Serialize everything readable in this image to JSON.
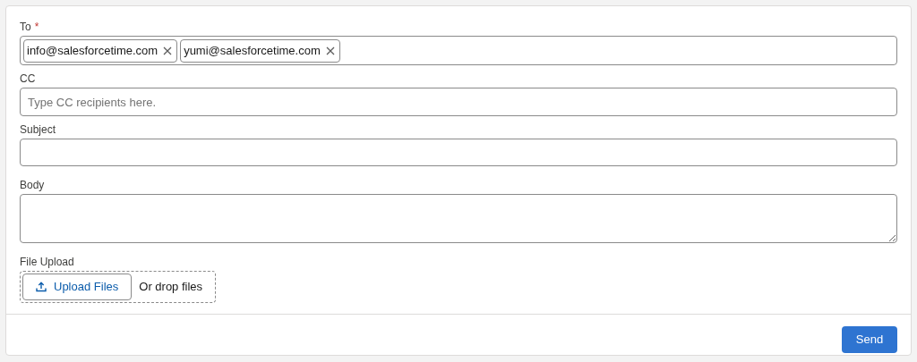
{
  "to": {
    "label": "To",
    "required_mark": "*",
    "recipients": [
      {
        "email": "info@salesforcetime.com"
      },
      {
        "email": "yumi@salesforcetime.com"
      }
    ]
  },
  "cc": {
    "label": "CC",
    "placeholder": "Type CC recipients here."
  },
  "subject": {
    "label": "Subject"
  },
  "body": {
    "label": "Body"
  },
  "file_upload": {
    "label": "File Upload",
    "button": "Upload Files",
    "drop_text": "Or drop files"
  },
  "footer": {
    "button": "Send"
  }
}
